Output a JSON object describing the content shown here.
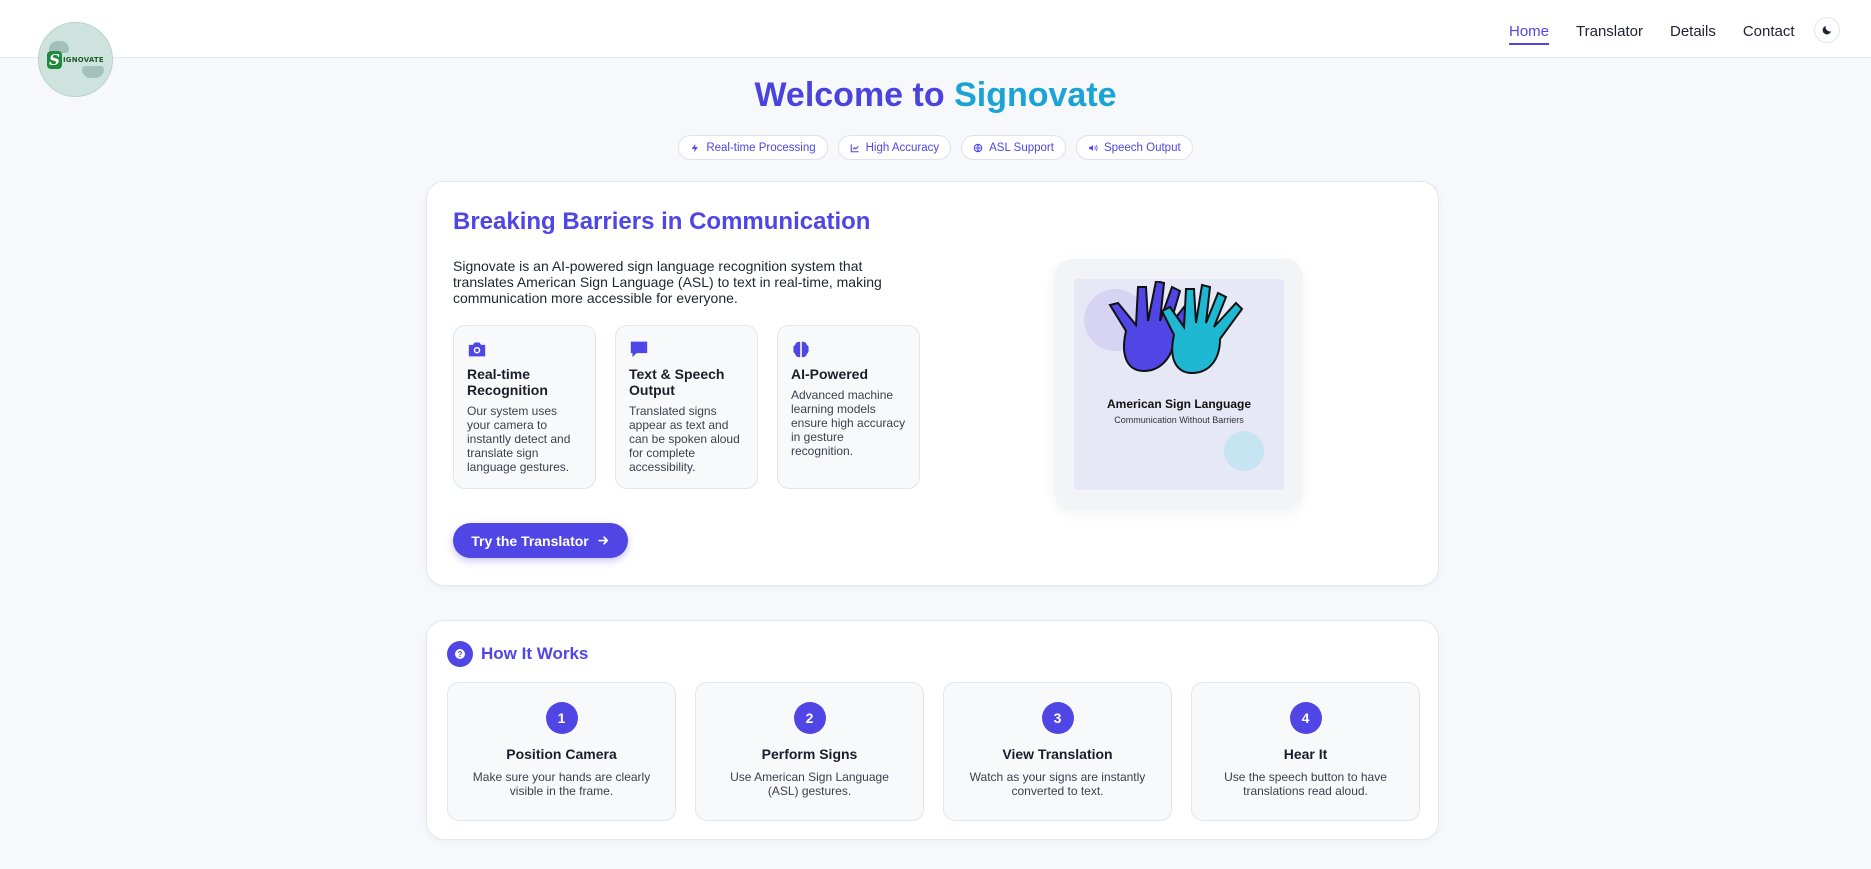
{
  "logo": {
    "initial": "S",
    "word": "IGNOVATE"
  },
  "nav": {
    "items": [
      {
        "label": "Home",
        "active": true
      },
      {
        "label": "Translator",
        "active": false
      },
      {
        "label": "Details",
        "active": false
      },
      {
        "label": "Contact",
        "active": false
      }
    ],
    "theme_toggle_icon": "moon-icon"
  },
  "hero": {
    "title_part1": "Welcome to",
    "title_part2": "Signovate",
    "chips": [
      {
        "label": "Real-time Processing",
        "icon": "bolt-icon"
      },
      {
        "label": "High Accuracy",
        "icon": "chart-line-icon"
      },
      {
        "label": "ASL Support",
        "icon": "globe-icon"
      },
      {
        "label": "Speech Output",
        "icon": "speaker-icon"
      }
    ]
  },
  "main": {
    "heading": "Breaking Barriers in Communication",
    "intro": "Signovate is an AI-powered sign language recognition system that translates American Sign Language (ASL) to text in real-time, making communication more accessible for everyone.",
    "features": [
      {
        "icon": "camera-icon",
        "title": "Real-time Recognition",
        "desc": "Our system uses your camera to instantly detect and translate sign language gestures."
      },
      {
        "icon": "speech-bubble-icon",
        "title": "Text & Speech Output",
        "desc": "Translated signs appear as text and can be spoken aloud for complete accessibility."
      },
      {
        "icon": "brain-icon",
        "title": "AI-Powered",
        "desc": "Advanced machine learning models ensure high accuracy in gesture recognition."
      }
    ],
    "cta_label": "Try the Translator",
    "illustration": {
      "title": "American Sign Language",
      "subtitle": "Communication Without Barriers"
    }
  },
  "how": {
    "heading": "How It Works",
    "steps": [
      {
        "num": "1",
        "title": "Position Camera",
        "desc": "Make sure your hands are clearly visible in the frame."
      },
      {
        "num": "2",
        "title": "Perform Signs",
        "desc": "Use American Sign Language (ASL) gestures."
      },
      {
        "num": "3",
        "title": "View Translation",
        "desc": "Watch as your signs are instantly converted to text."
      },
      {
        "num": "4",
        "title": "Hear It",
        "desc": "Use the speech button to have translations read aloud."
      }
    ]
  },
  "colors": {
    "accent": "#4f46e5",
    "accent_cyan": "#1ba3d6",
    "background": "#f6f8fb"
  }
}
